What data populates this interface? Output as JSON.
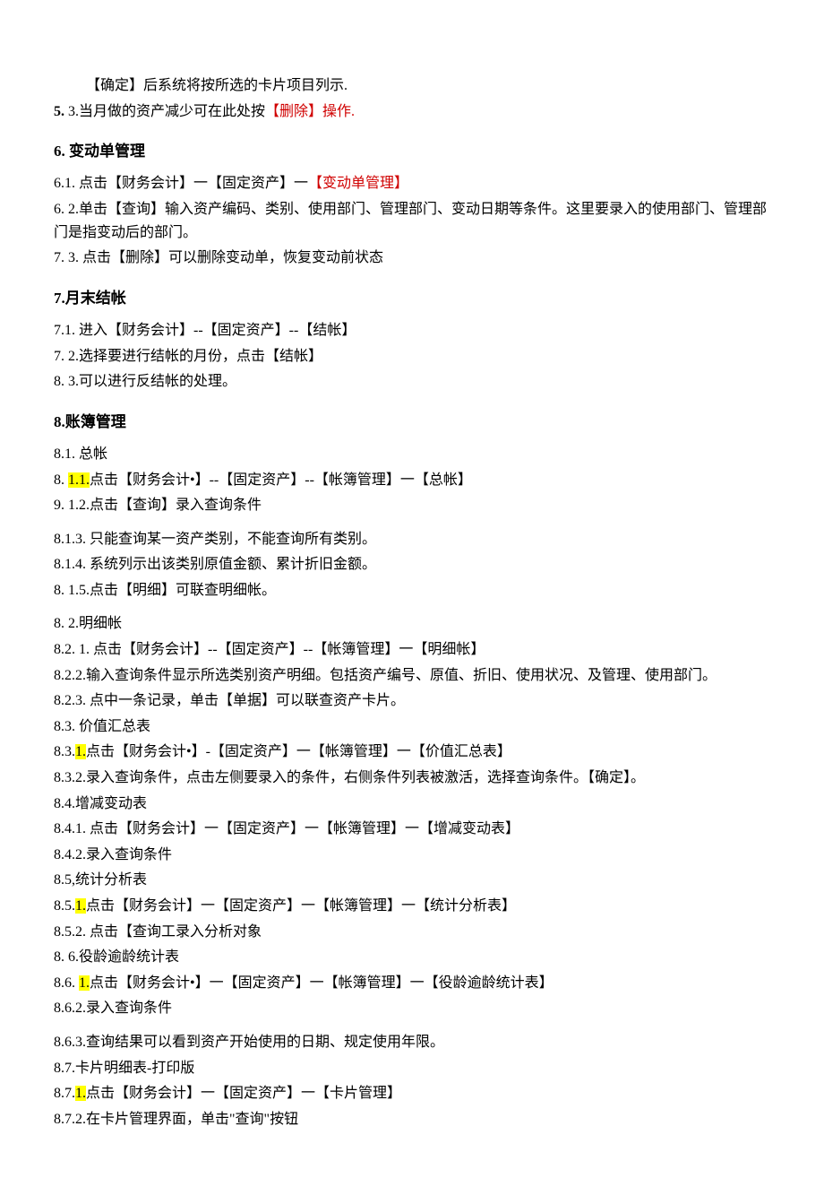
{
  "p1": "【确定】后系统将按所选的卡片项目列示.",
  "p2_prefix": "5.",
  "p2": " 3.当月做的资产减少可在此处按",
  "p2_red": "【删除】",
  "p2_tail": "操作.",
  "h6": "6.  变动单管理",
  "l6_1a": "6.1. 点击【财务会计】一【固定资产】一",
  "l6_1b": "【变动单管理】",
  "l6_2": "6.  2.单击【查询】输入资产编码、类别、使用部门、管理部门、变动日期等条件。这里要录入的使用部门、管理部门是指变动后的部门。",
  "l6_3": "7.  3. 点击【删除】可以删除变动单，恢复变动前状态",
  "h7": "7.月末结帐",
  "l7_1": "7.1.    进入【财务会计】--【固定资产】--【结帐】",
  "l7_2": "7.  2.选择要进行结帐的月份，点击【结帐】",
  "l7_3": "8.  3.可以进行反结帐的处理。",
  "h8": "8.账簿管理",
  "l8_1": "8.1.   总帐",
  "l8_1_1a": "8.  ",
  "l8_1_1hl": "1.1.",
  "l8_1_1b": "点击【财务会计•】--【固定资产】--【帐簿管理】一【总帐】",
  "l8_1_2": "9.  1.2.点击【查询】录入查询条件",
  "l8_1_3": "8.1.3.    只能查询某一资产类别，不能查询所有类别。",
  "l8_1_4": "8.1.4.    系统列示出该类别原值金额、累计折旧金额。",
  "l8_1_5": "8.  1.5.点击【明细】可联查明细帐。",
  "l8_2": "8.  2.明细帐",
  "l8_2_1": "8.2.   1. 点击【财务会计】--【固定资产】--【帐簿管理】一【明细帐】",
  "l8_2_2": "8.2.2.输入查询条件显示所选类别资产明细。包括资产编号、原值、折旧、使用状况、及管理、使用部门。",
  "l8_2_3": "8.2.3. 点中一条记录，单击【单据】可以联查资产卡片。",
  "l8_3": "8.3. 价值汇总表",
  "l8_3_1a": "8.3.",
  "l8_3_1hl": "1.",
  "l8_3_1b": "点击【财务会计•】-【固定资产】一【帐簿管理】一【价值汇总表】",
  "l8_3_2": "8.3.2.录入查询条件，点击左侧要录入的条件，右侧条件列表被激活，选择查询条件。【确定】。",
  "l8_4": "8.4.增减变动表",
  "l8_4_1": "8.4.1. 点击【财务会计】一【固定资产】一【帐簿管理】一【增减变动表】",
  "l8_4_2": "8.4.2.录入查询条件",
  "l8_5": "8.5,统计分析表",
  "l8_5_1a": "8.5.",
  "l8_5_1hl": "1.",
  "l8_5_1b": "点击【财务会计】一【固定资产】一【帐簿管理】一【统计分析表】",
  "l8_5_2": "8.5.2. 点击【查询工录入分析对象",
  "l8_6": "8.  6.役龄逾龄统计表",
  "l8_6_1a": "8.6.   ",
  "l8_6_1hl": "1.",
  "l8_6_1b": "点击【财务会计•】一【固定资产】一【帐簿管理】一【役龄逾龄统计表】",
  "l8_6_2": "8.6.2.录入查询条件",
  "l8_6_3": "8.6.3.查询结果可以看到资产开始使用的日期、规定使用年限。",
  "l8_7": "8.7.卡片明细表-打印版",
  "l8_7_1a": "8.7.",
  "l8_7_1hl": "1.",
  "l8_7_1b": "点击【财务会计】一【固定资产】一【卡片管理】",
  "l8_7_2": "8.7.2.在卡片管理界面，单击\"查询\"按钮"
}
